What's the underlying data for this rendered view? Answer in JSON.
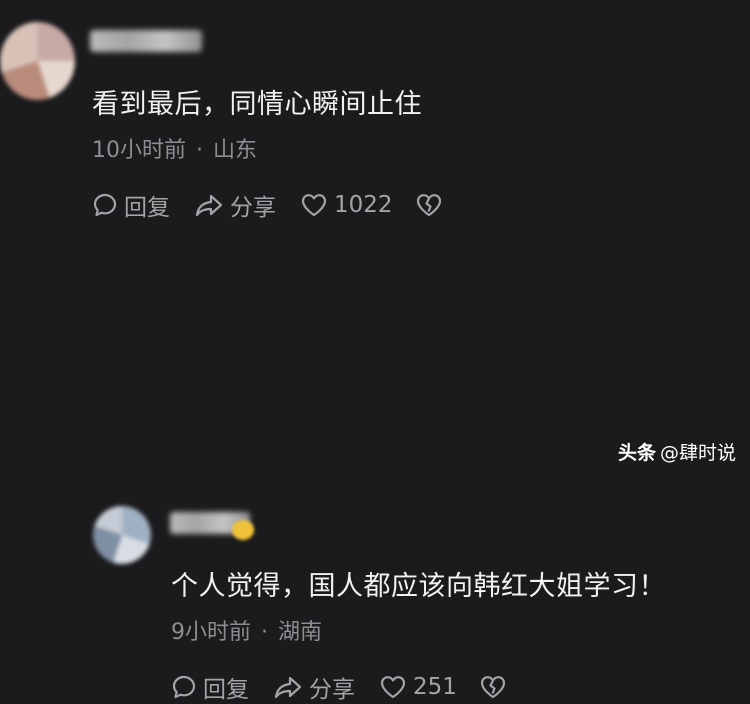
{
  "comments": [
    {
      "text": "看到最后，同情心瞬间止住",
      "time": "10小时前",
      "location": "山东",
      "reply_label": "回复",
      "share_label": "分享",
      "like_count": "1022"
    },
    {
      "text": "个人觉得，国人都应该向韩红大姐学习！",
      "time": "9小时前",
      "location": "湖南",
      "reply_label": "回复",
      "share_label": "分享",
      "like_count": "251"
    }
  ],
  "separator": "·",
  "watermark": {
    "brand": "头条",
    "handle": "@肆时说"
  },
  "icons": {
    "reply": "speech-bubble-icon",
    "share": "share-arrow-icon",
    "like": "heart-icon",
    "dislike": "broken-heart-icon"
  }
}
